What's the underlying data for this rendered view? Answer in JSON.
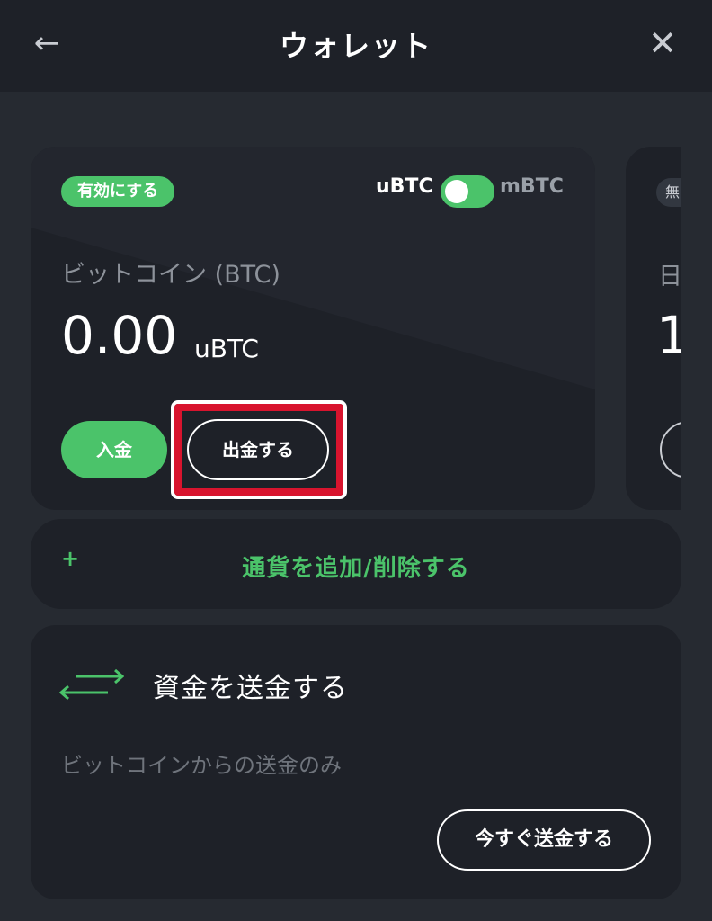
{
  "header": {
    "back_icon": "arrow-left-icon",
    "title": "ウォレット",
    "close_icon": "close-icon"
  },
  "wallet_card": {
    "status_badge": "有効にする",
    "unit_toggle": {
      "left_label": "uBTC",
      "right_label": "mBTC",
      "state": "on"
    },
    "coin_name": "ビットコイン (BTC)",
    "balance": "0.00",
    "balance_unit": "uBTC",
    "deposit_label": "入金",
    "withdraw_label": "出金する"
  },
  "next_card_peek": {
    "badge_fragment": "無",
    "name_fragment": "日",
    "balance_fragment": "1"
  },
  "add_currency": {
    "plus": "+",
    "label": "通貨を追加/削除する"
  },
  "send_card": {
    "icon": "transfer-arrows-icon",
    "title": "資金を送金する",
    "subtitle": "ビットコインからの送金のみ",
    "button_label": "今すぐ送金する"
  },
  "colors": {
    "accent": "#4bc36a",
    "highlight": "#d8142e",
    "card": "#1e2128",
    "background": "#262a31"
  }
}
